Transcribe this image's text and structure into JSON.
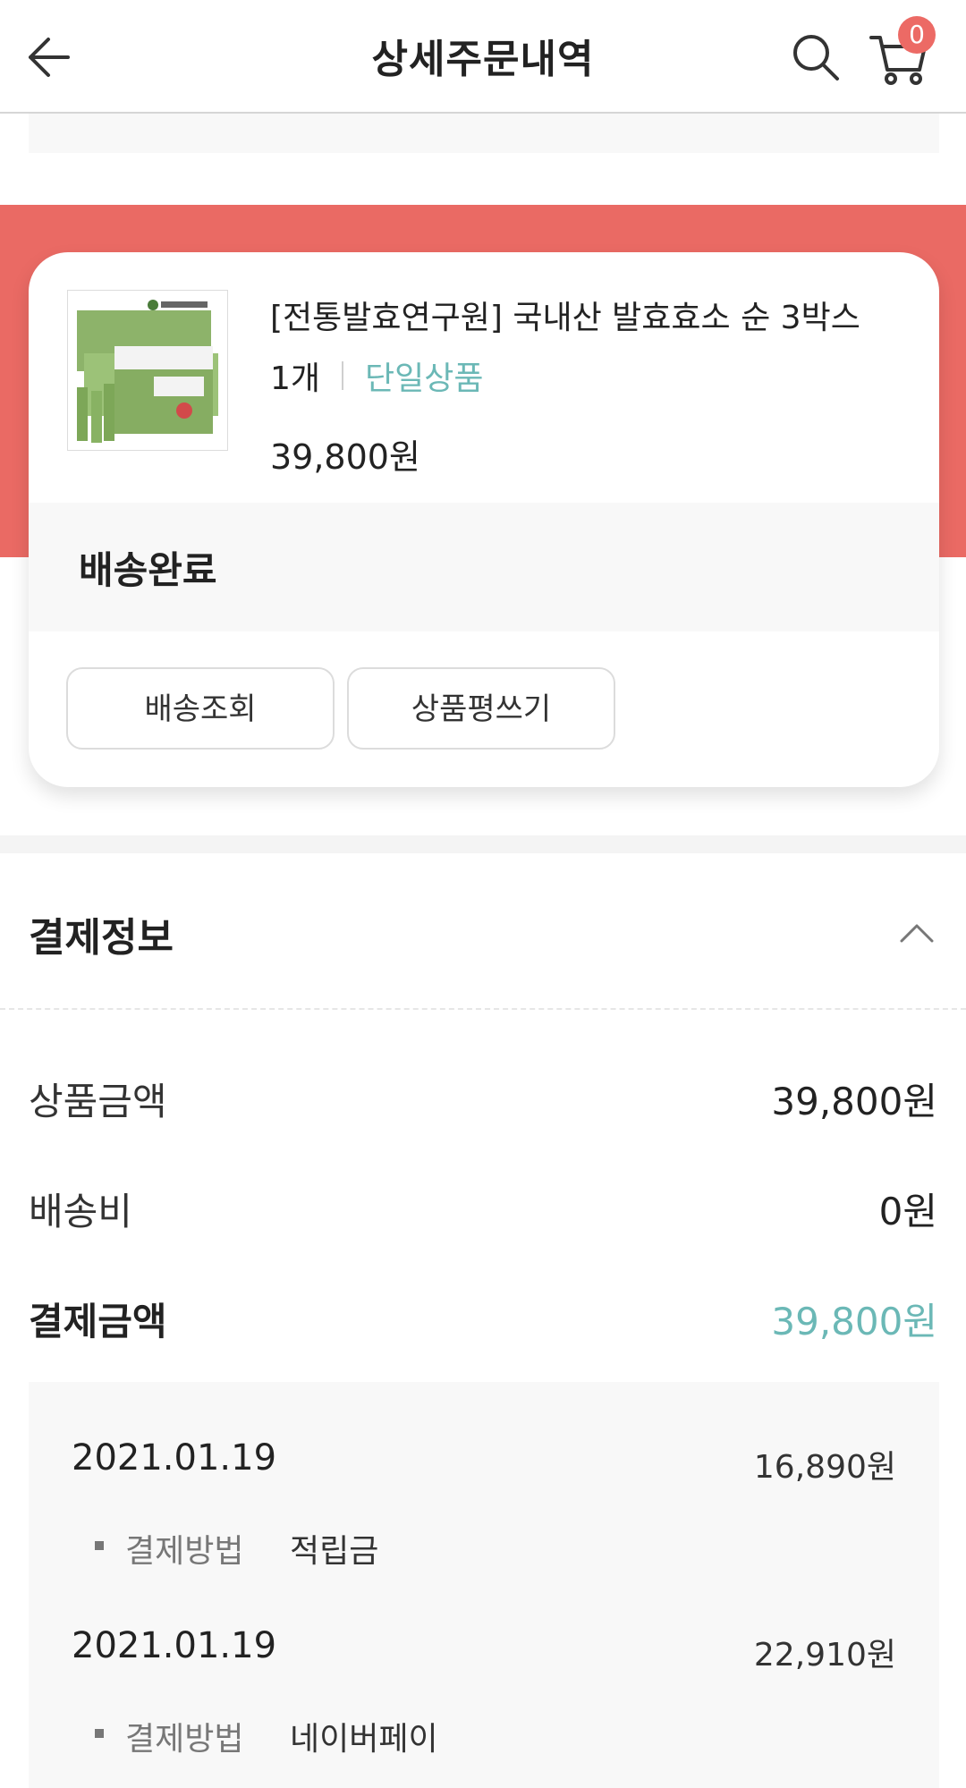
{
  "header": {
    "title": "상세주문내역",
    "cart_count": "0",
    "icons": [
      "back-arrow-icon",
      "search-icon",
      "cart-icon"
    ]
  },
  "order": {
    "product_name": "[전통발효연구원] 국내산 발효효소 순 3박스",
    "quantity": "1개",
    "option": "단일상품",
    "price": "39,800원",
    "status": "배송완료",
    "buttons": {
      "tracking": "배송조회",
      "review": "상품평쓰기"
    }
  },
  "payment": {
    "title": "결제정보",
    "rows": {
      "product_amount": {
        "label": "상품금액",
        "value": "39,800원"
      },
      "shipping": {
        "label": "배송비",
        "value": "0원"
      },
      "total": {
        "label": "결제금액",
        "value": "39,800원"
      }
    },
    "details": [
      {
        "date": "2021.01.19",
        "amount": "16,890원",
        "method_label": "결제방법",
        "method": "적립금"
      },
      {
        "date": "2021.01.19",
        "amount": "22,910원",
        "method_label": "결제방법",
        "method": "네이버페이"
      }
    ]
  },
  "colors": {
    "accent_red": "#ea6a64",
    "accent_teal": "#6bb8b6",
    "badge": "#ec6a65"
  }
}
